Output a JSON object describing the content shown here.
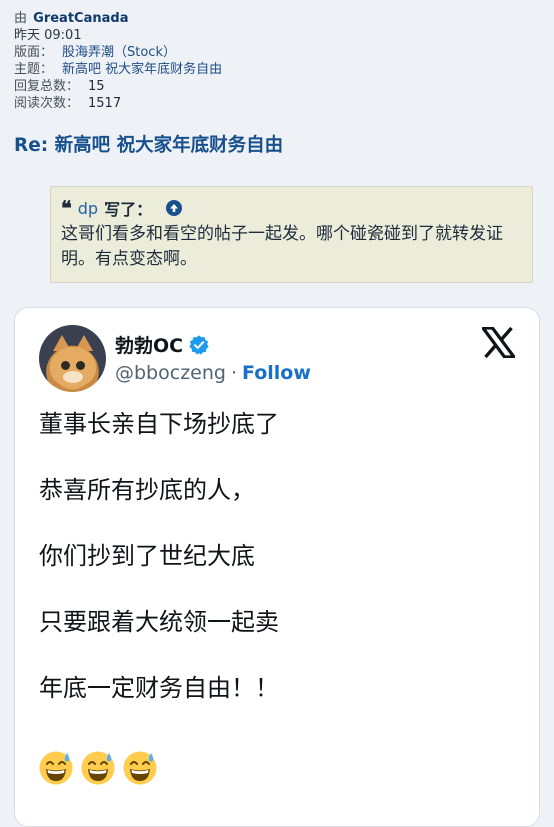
{
  "meta": {
    "author_label": "由",
    "author": "GreatCanada",
    "time": "昨天 09:01",
    "board_label": "版面：",
    "board": "股海弄潮（Stock）",
    "subject_label": "主题：",
    "subject": "新高吧 祝大家年底财务自由",
    "replies_label": "回复总数：",
    "replies": "15",
    "views_label": "阅读次数：",
    "views": "1517"
  },
  "post": {
    "title": "Re: 新高吧 祝大家年底财务自由"
  },
  "quote": {
    "mark": "❝",
    "user": "dp",
    "said": "写了：",
    "body": "这哥们看多和看空的帖子一起发。哪个碰瓷碰到了就转发证明。有点变态啊。"
  },
  "tweet": {
    "name": "勃勃OC",
    "handle": "@bboczeng",
    "separator": "·",
    "follow": "Follow",
    "lines": [
      "董事长亲自下场抄底了",
      "恭喜所有抄底的人，",
      "你们抄到了世纪大底",
      "只要跟着大统领一起卖",
      "年底一定财务自由！！"
    ],
    "emoji_icon": "grinning-face-with-sweat-icon",
    "emoji_count": 3
  },
  "colors": {
    "link_blue": "#17508d",
    "follow_blue": "#1870c9",
    "quote_bg": "#ebecda",
    "verified_blue": "#1d9bf0"
  }
}
